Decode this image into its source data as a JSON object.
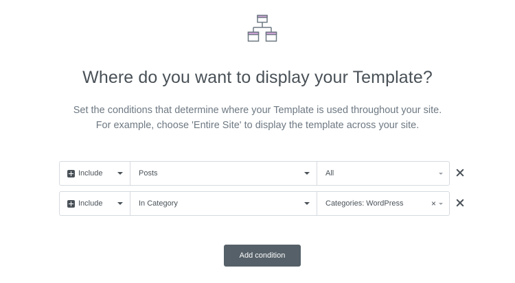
{
  "hero": {
    "icon": "sitemap-icon",
    "title": "Where do you want to display your Template?",
    "subtitle_line1": "Set the conditions that determine where your Template is used throughout your site.",
    "subtitle_line2": "For example, choose 'Entire Site' to display the template across your site."
  },
  "conditions": [
    {
      "type": "Include",
      "name": "Posts",
      "sub": "All",
      "clearable": false
    },
    {
      "type": "Include",
      "name": "In Category",
      "sub": "Categories: WordPress",
      "clearable": true
    }
  ],
  "add_button_label": "Add condition",
  "colors": {
    "accent_pink": "#d8a8df",
    "icon_stroke": "#6d7882",
    "button_bg": "#556068"
  }
}
